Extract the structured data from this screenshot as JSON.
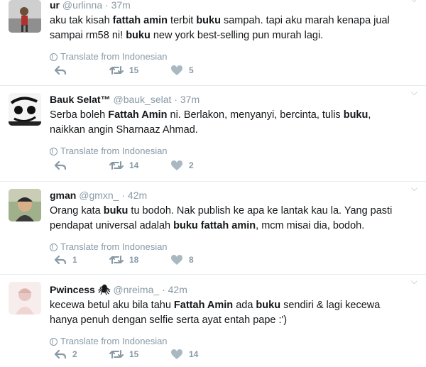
{
  "translate_label": "Translate from Indonesian",
  "tweets": [
    {
      "name": "ur",
      "handle": "@urlinna",
      "time": "37m",
      "text_segments": [
        {
          "t": "aku tak kisah ",
          "b": false
        },
        {
          "t": "fattah amin",
          "b": true
        },
        {
          "t": " terbit ",
          "b": false
        },
        {
          "t": "buku",
          "b": true
        },
        {
          "t": " sampah. tapi aku marah kenapa jual sampai rm58 ni! ",
          "b": false
        },
        {
          "t": "buku",
          "b": true
        },
        {
          "t": " new york best-selling pun murah lagi.",
          "b": false
        }
      ],
      "reply_count": "",
      "retweet_count": "15",
      "like_count": "5"
    },
    {
      "name": "Bauk Selat™",
      "handle": "@bauk_selat",
      "time": "37m",
      "text_segments": [
        {
          "t": "Serba boleh ",
          "b": false
        },
        {
          "t": "Fattah Amin",
          "b": true
        },
        {
          "t": " ni. Berlakon, menyanyi, bercinta, tulis ",
          "b": false
        },
        {
          "t": "buku",
          "b": true
        },
        {
          "t": ", naikkan angin Sharnaaz Ahmad.",
          "b": false
        }
      ],
      "reply_count": "",
      "retweet_count": "14",
      "like_count": "2"
    },
    {
      "name": "gman",
      "handle": "@gmxn_",
      "time": "42m",
      "text_segments": [
        {
          "t": "Orang kata ",
          "b": false
        },
        {
          "t": "buku",
          "b": true
        },
        {
          "t": " tu bodoh. Nak publish ke apa ke lantak kau la. Yang pasti pendapat universal adalah ",
          "b": false
        },
        {
          "t": "buku fattah amin",
          "b": true
        },
        {
          "t": ", mcm misai dia, bodoh.",
          "b": false
        }
      ],
      "reply_count": "1",
      "retweet_count": "18",
      "like_count": "8"
    },
    {
      "name": "Pwincess 🕷",
      "handle": "@nreima_",
      "time": "42m",
      "text_segments": [
        {
          "t": "kecewa betul aku bila tahu ",
          "b": false
        },
        {
          "t": "Fattah Amin",
          "b": true
        },
        {
          "t": " ada ",
          "b": false
        },
        {
          "t": "buku",
          "b": true
        },
        {
          "t": " sendiri & lagi kecewa hanya penuh dengan selfie serta ayat entah pape :')",
          "b": false
        }
      ],
      "reply_count": "2",
      "retweet_count": "15",
      "like_count": "14"
    }
  ]
}
